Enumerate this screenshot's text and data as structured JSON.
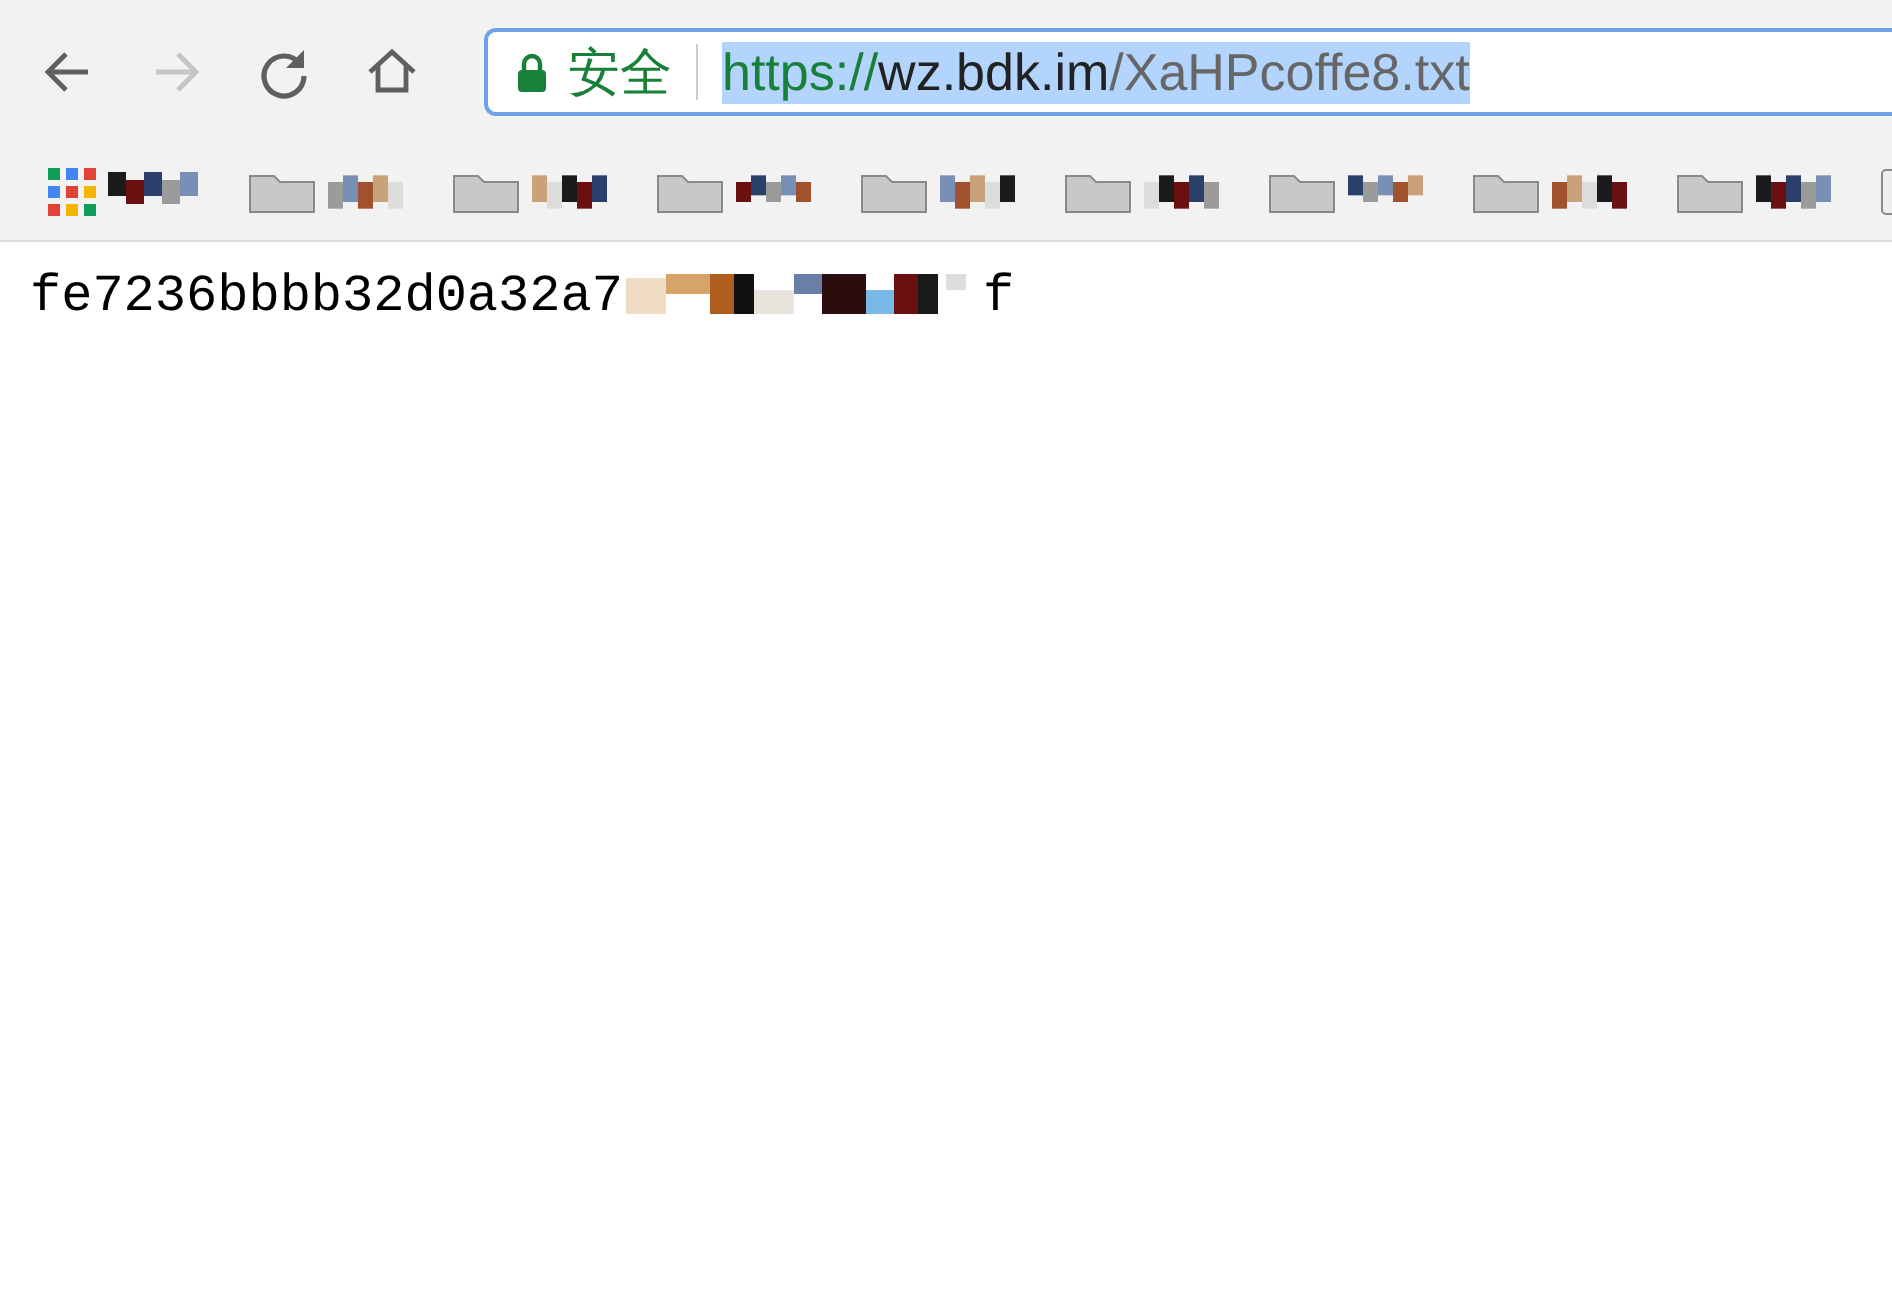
{
  "toolbar": {
    "buttons": [
      {
        "kind": "back",
        "disabled": false
      },
      {
        "kind": "forward",
        "disabled": true
      },
      {
        "kind": "reload",
        "disabled": false
      },
      {
        "kind": "home",
        "disabled": false
      }
    ]
  },
  "address_bar": {
    "security_label": "安全",
    "selected": true,
    "url_parts": [
      {
        "kind": "scheme",
        "text": "https://"
      },
      {
        "kind": "host",
        "text": "wz.bdk.im"
      },
      {
        "kind": "path",
        "text": "/XaHPcoffe8.txt"
      }
    ]
  },
  "bookmarks": [
    {
      "kind": "apps"
    },
    {
      "kind": "folder"
    },
    {
      "kind": "folder"
    },
    {
      "kind": "folder"
    },
    {
      "kind": "folder"
    },
    {
      "kind": "folder"
    },
    {
      "kind": "folder"
    },
    {
      "kind": "folder"
    },
    {
      "kind": "folder"
    },
    {
      "kind": "page"
    }
  ],
  "document": {
    "text_start": "fe7236bbbb32d0a32a7",
    "text_end": "f"
  }
}
